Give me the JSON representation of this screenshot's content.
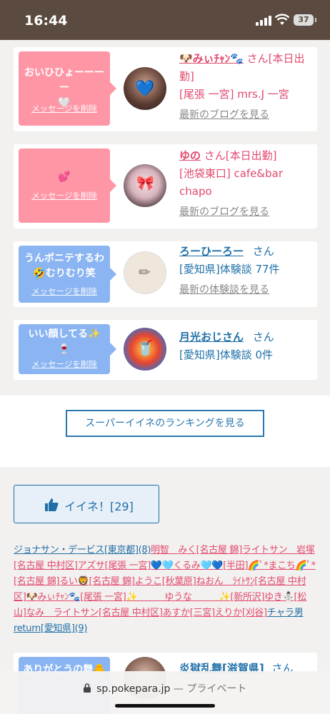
{
  "status": {
    "time": "16:44",
    "battery": "37"
  },
  "cards": [
    {
      "message": "おいひひょーーーー\n🤍",
      "delete": "メッセージを削除",
      "color": "pink",
      "name": "🐶みぃﾁｬﾝ🐾",
      "suffix": "さん[本日出勤]",
      "shop": "[尾張 一宮] mrs.J 一宮",
      "link": "最新のブログを見る",
      "avatar_emoji": "💙"
    },
    {
      "message": "💕",
      "delete": "メッセージを削除",
      "color": "pink",
      "name": "ゆの",
      "suffix": "さん[本日出勤]",
      "shop": "[池袋東口] cafe&bar chapo",
      "link": "最新のブログを見る",
      "avatar_emoji": "🎀"
    },
    {
      "message": "うんポニテするわ\n🤣むりむり笑",
      "delete": "メッセージを削除",
      "color": "blue",
      "name": "ろーひーろー",
      "suffix": "さん",
      "shop": "[愛知県]体験談 77件",
      "link": "最新の体験談を見る",
      "avatar_emoji": "✏"
    },
    {
      "message": "いい顔してる✨\n🍷",
      "delete": "メッセージを削除",
      "color": "blue",
      "name": "月光おじさん",
      "suffix": "さん",
      "shop": "[愛知県]体験談 0件",
      "link": "",
      "avatar_emoji": "🥤"
    },
    {
      "message": "ありがとうの舞🐥",
      "delete": "",
      "color": "blue",
      "name": "炎獄乱舞[滋賀県]",
      "suffix": "さん",
      "shop": "",
      "link": "",
      "avatar_emoji": ""
    }
  ],
  "ranking_button": "スーパーイイネのランキングを見る",
  "iine": {
    "label": "イイネ！[29]"
  },
  "likers": [
    {
      "t": "ジョナサン・デービス[東京都](8)",
      "c": "b"
    },
    {
      "t": "明智　みく[名古屋 錦]",
      "c": "p"
    },
    {
      "t": "ライトサン　岩塚[名古屋 中村区]",
      "c": "p"
    },
    {
      "t": "アズサ[尾張 一宮]",
      "c": "p"
    },
    {
      "t": "💙🩵くるみ🩵💙[半田]",
      "c": "p"
    },
    {
      "t": "🌈ﾟ*まこち🌈ﾟ*[名古屋 錦]",
      "c": "p"
    },
    {
      "t": "るい🦁[名古屋 錦]",
      "c": "p"
    },
    {
      "t": "ようこ[秋葉原]",
      "c": "p"
    },
    {
      "t": "ねおん　ﾗｲﾄｻﾝ[名古屋 中村区]",
      "c": "p"
    },
    {
      "t": "🐶みぃﾁｬﾝ🐾[尾張 一宮]",
      "c": "p"
    },
    {
      "t": "✨　　　ゆうな　　　✨[新所沢]",
      "c": "p"
    },
    {
      "t": "ゆき⛄[松山]",
      "c": "p"
    },
    {
      "t": "なみ　ライトサン[名古屋 中村区]",
      "c": "p"
    },
    {
      "t": "あすか[三宮]",
      "c": "p"
    },
    {
      "t": "えりか[刈谷]",
      "c": "p"
    },
    {
      "t": "チャラ男return[愛知県](9)",
      "c": "b"
    }
  ],
  "browser": {
    "domain": "sp.pokepara.jp",
    "private": "— プライベート"
  }
}
